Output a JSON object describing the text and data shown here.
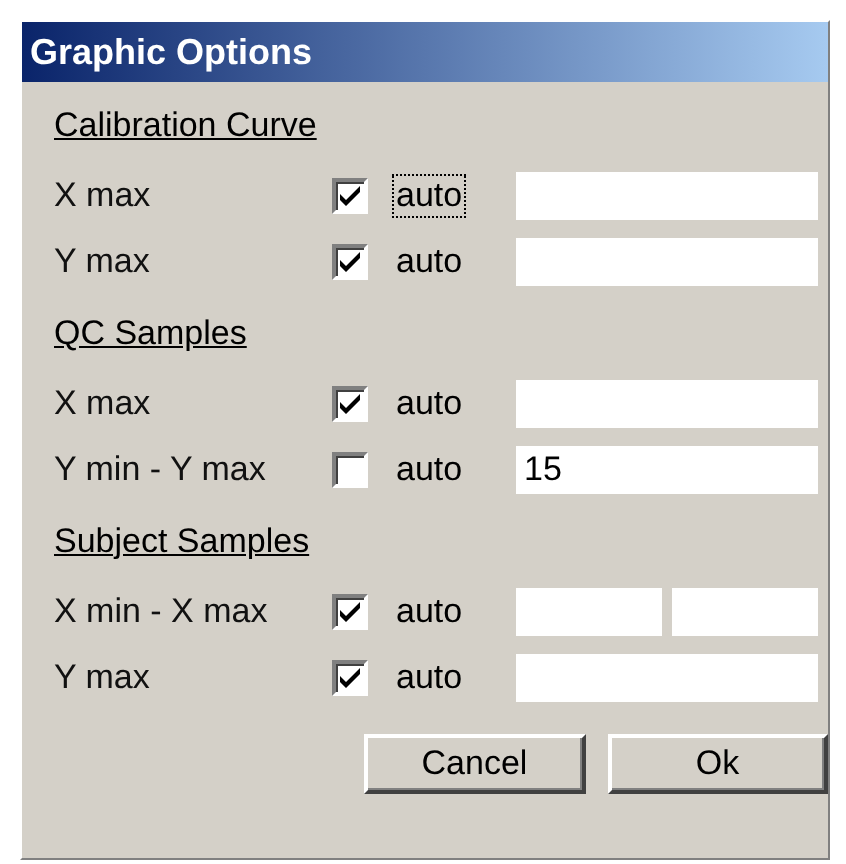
{
  "window": {
    "title": "Graphic Options"
  },
  "sections": [
    {
      "title": "Calibration Curve",
      "rows": [
        {
          "label": "X max",
          "checked": true,
          "check_label": "auto",
          "focused": true,
          "kind": "single"
        },
        {
          "label": "Y max",
          "checked": true,
          "check_label": "auto",
          "focused": false,
          "kind": "single"
        }
      ]
    },
    {
      "title": "QC Samples",
      "rows": [
        {
          "label": "X max",
          "checked": true,
          "check_label": "auto",
          "focused": false,
          "kind": "single"
        },
        {
          "label": "Y min - Y max",
          "checked": false,
          "check_label": "auto",
          "focused": false,
          "kind": "single",
          "value": "15"
        }
      ]
    },
    {
      "title": "Subject Samples",
      "rows": [
        {
          "label": "X min - X max",
          "checked": true,
          "check_label": "auto",
          "focused": false,
          "kind": "range"
        },
        {
          "label": "Y max",
          "checked": true,
          "check_label": "auto",
          "focused": false,
          "kind": "single"
        }
      ]
    }
  ],
  "buttons": [
    "Cancel",
    "Ok"
  ]
}
